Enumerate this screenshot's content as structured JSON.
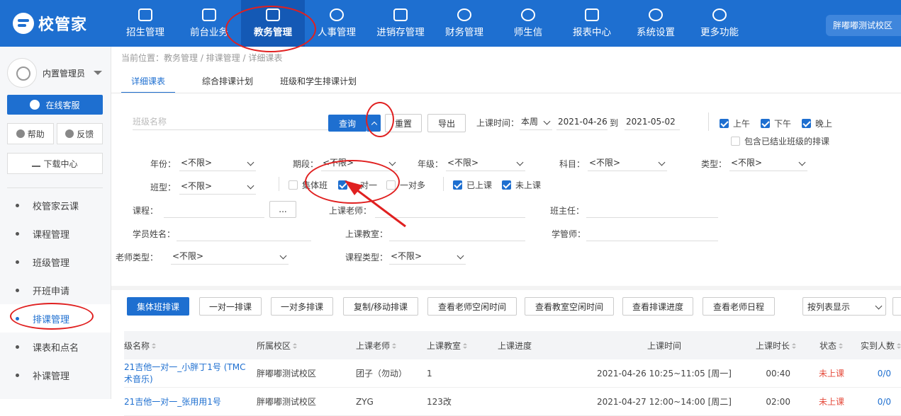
{
  "app": {
    "logo_text": "校管家",
    "campus": "胖嘟嘟测试校区"
  },
  "nav": [
    {
      "label": "招生管理",
      "icon": "person-add-icon"
    },
    {
      "label": "前台业务",
      "icon": "monitor-icon"
    },
    {
      "label": "教务管理",
      "icon": "book-icon",
      "active": true
    },
    {
      "label": "人事管理",
      "icon": "person-icon"
    },
    {
      "label": "进销存管理",
      "icon": "arrow-box-icon"
    },
    {
      "label": "财务管理",
      "icon": "yen-icon"
    },
    {
      "label": "师生信",
      "icon": "chat-icon"
    },
    {
      "label": "报表中心",
      "icon": "chart-icon"
    },
    {
      "label": "系统设置",
      "icon": "settings-icon"
    },
    {
      "label": "更多功能",
      "icon": "more-icon"
    }
  ],
  "sidebar": {
    "user_name": "内置管理员",
    "online_service": "在线客服",
    "help": "帮助",
    "feedback": "反馈",
    "download": "下载中心",
    "items": [
      {
        "label": "校管家云课"
      },
      {
        "label": "课程管理"
      },
      {
        "label": "班级管理"
      },
      {
        "label": "开班申请"
      },
      {
        "label": "排课管理",
        "active": true
      },
      {
        "label": "课表和点名"
      },
      {
        "label": "补课管理"
      }
    ]
  },
  "breadcrumb": "当前位置：教务管理 / 排课管理 / 详细课表",
  "tabs": [
    {
      "label": "详细课表",
      "active": true
    },
    {
      "label": "综合排课计划"
    },
    {
      "label": "班级和学生排课计划"
    }
  ],
  "filters": {
    "class_name_placeholder": "班级名称",
    "query": "查询",
    "reset": "重置",
    "export": "导出",
    "time_label": "上课时间：",
    "time_range": "本周",
    "date_from": "2021-04-26",
    "to": "到",
    "date_to": "2021-05-02",
    "morning": "上午",
    "afternoon": "下午",
    "evening": "晚上",
    "include_graduated": "包含已结业班级的排课",
    "year_label": "年份：",
    "period_label": "期段：",
    "grade_label": "年级：",
    "subject_label": "科目：",
    "type_label": "类型：",
    "class_type_label": "班型：",
    "unlimited": "<不限>",
    "group_class": "集体班",
    "one_on_one": "一对一",
    "one_to_many": "一对多",
    "attended": "已上课",
    "not_attended": "未上课",
    "course_label": "课程：",
    "course_btn": "...",
    "teacher_label": "上课老师：",
    "head_teacher_label": "班主任：",
    "student_label": "学员姓名：",
    "classroom_label": "上课教室：",
    "academic_label": "学管师：",
    "teacher_type_label": "老师类型：",
    "course_type_label": "课程类型："
  },
  "actions": {
    "group_schedule": "集体班排课",
    "one_on_one_schedule": "一对一排课",
    "one_to_many_schedule": "一对多排课",
    "copy_move": "复制/移动排课",
    "teacher_free": "查看老师空闲时间",
    "room_free": "查看教室空闲时间",
    "progress": "查看排课进度",
    "teacher_calendar": "查看老师日程",
    "view_mode": "按列表显示"
  },
  "table": {
    "headers": [
      "级名称",
      "所属校区",
      "上课老师",
      "上课教室",
      "上课进度",
      "上课时间",
      "上课时长",
      "状态",
      "实到人数"
    ],
    "rows": [
      {
        "name": "21吉他一对一_小胖丁1号 (TMC",
        "name2": "术音乐)",
        "campus": "胖嘟嘟测试校区",
        "teacher": "团子（勿动）",
        "room": "1",
        "progress": "",
        "time": "2021-04-26 10:25~11:05 [周一]",
        "duration": "00:40",
        "status": "未上课",
        "count": "0/0"
      },
      {
        "name": "21吉他一对一_张用用1号",
        "name2": "",
        "campus": "胖嘟嘟测试校区",
        "teacher": "ZYG",
        "room": "123改",
        "progress": "",
        "time": "2021-04-27 12:00~14:00 [周二]",
        "duration": "02:00",
        "status": "未上课",
        "count": "0/0"
      }
    ]
  }
}
